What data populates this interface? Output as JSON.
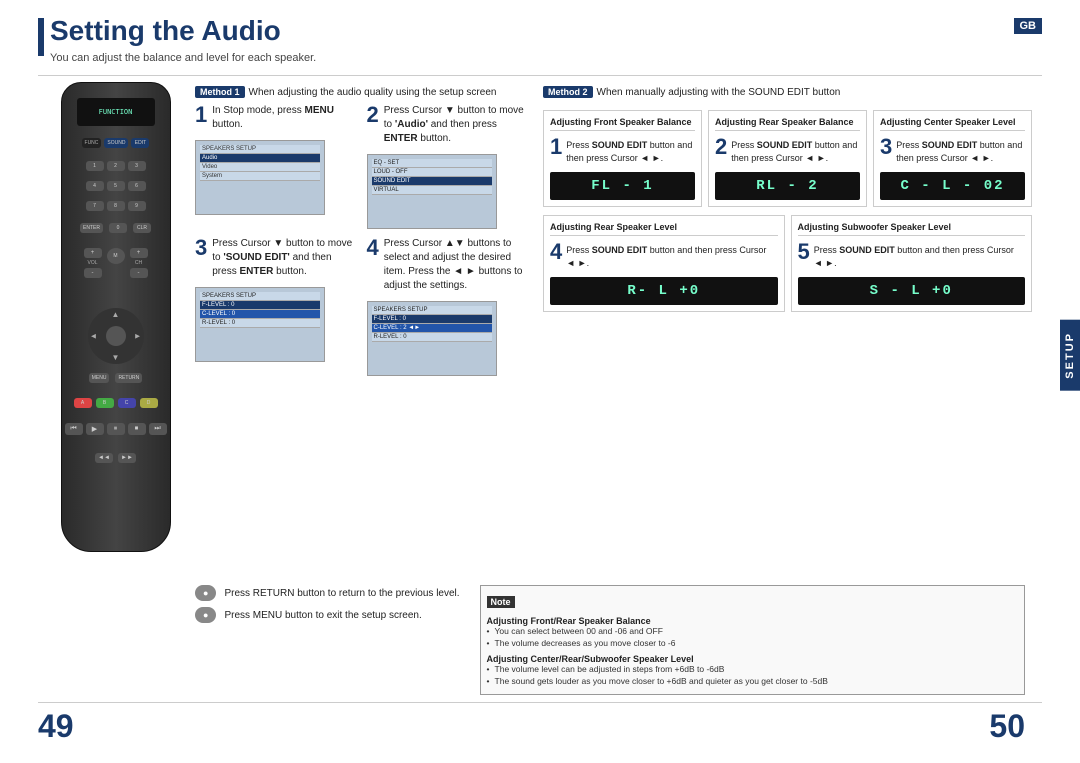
{
  "page": {
    "title": "Setting the Audio",
    "subtitle": "You can adjust the balance and level for each speaker.",
    "gb_label": "GB",
    "setup_tab": "SETUP",
    "page_num_left": "49",
    "page_num_right": "50"
  },
  "method1": {
    "badge": "Method 1",
    "description": "When adjusting the audio quality using the setup screen",
    "steps": [
      {
        "number": "1",
        "text": "In Stop mode, press MENU button."
      },
      {
        "number": "2",
        "text": "Press Cursor ▼ button to move to 'Audio' and then press ENTER button."
      },
      {
        "number": "3",
        "text": "Press Cursor ▼ button to move to 'SOUND EDIT' and then press ENTER button."
      },
      {
        "number": "4",
        "text": "Press Cursor ▲▼ buttons to select and adjust the desired item. Press the ◄► buttons to adjust the settings."
      }
    ]
  },
  "method2": {
    "badge": "Method 2",
    "description": "When manually adjusting with the SOUND EDIT button",
    "speakers": [
      {
        "header": "Adjusting Front Speaker Balance",
        "step": "1",
        "desc": "Press SOUND EDIT button and then press Cursor ◄ ►.",
        "display": "FL - 1"
      },
      {
        "header": "Adjusting Rear Speaker Balance",
        "step": "2",
        "desc": "Press SOUND EDIT button and then press Cursor ◄ ►.",
        "display": "RL - 2"
      },
      {
        "header": "Adjusting Center Speaker Level",
        "step": "3",
        "desc": "Press SOUND EDIT button and then press Cursor ◄ ►.",
        "display": "C - L - 02"
      },
      {
        "header": "Adjusting Rear Speaker Level",
        "step": "4",
        "desc": "Press SOUND EDIT button and then press Cursor ◄ ►.",
        "display": "R- L +0"
      },
      {
        "header": "Adjusting Subwoofer Speaker Level",
        "step": "5",
        "desc": "Press SOUND EDIT button and then press Cursor ◄ ►.",
        "display": "S - L +0"
      }
    ]
  },
  "bottom": {
    "return_text": "Press RETURN button to return to the previous level.",
    "menu_text": "Press MENU button to exit the setup screen.",
    "note_title": "Note",
    "note_sections": [
      {
        "title": "Adjusting Front/Rear Speaker Balance",
        "items": [
          "You can select between 00 and -06 and OFF",
          "The volume decreases as you move closer to -6"
        ]
      },
      {
        "title": "Adjusting Center/Rear/Subwoofer Speaker Level",
        "items": [
          "The volume level can be adjusted in steps from +6dB to -6dB",
          "The sound gets louder as you move closer to +6dB and quieter as you get closer to -5dB"
        ]
      }
    ]
  }
}
